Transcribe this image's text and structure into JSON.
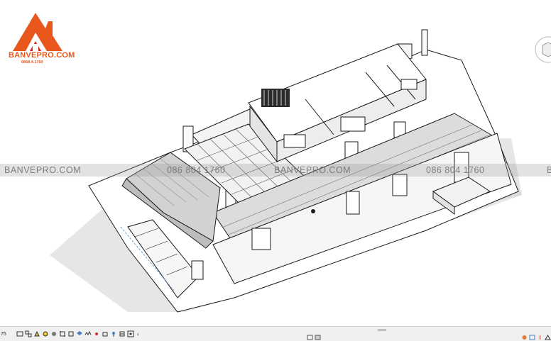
{
  "logo": {
    "name": "BANVEPRO.COM",
    "phone": "0868.4.1760"
  },
  "watermarks": [
    "BANVEPRO.COM",
    "086 804 1760",
    "BANVEPRO.COM",
    "086 804 1760",
    "B"
  ],
  "statusbar": {
    "scale": "75"
  },
  "colors": {
    "brand_orange": "#e8571b",
    "brand_red": "#d9261c",
    "line": "#1a1a1a",
    "shadow": "#d8d8d8"
  },
  "icons": [
    "view-scale-icon",
    "detail-level-icon",
    "visual-style-icon",
    "sun-path-icon",
    "shadows-icon",
    "crop-icon",
    "show-crop-icon",
    "unlock-3d-icon",
    "temporary-hide-icon",
    "reveal-hidden-icon",
    "worksharing-icon",
    "analysis-icon",
    "highlight-icon",
    "constraints-icon",
    "chevron-left-icon"
  ]
}
